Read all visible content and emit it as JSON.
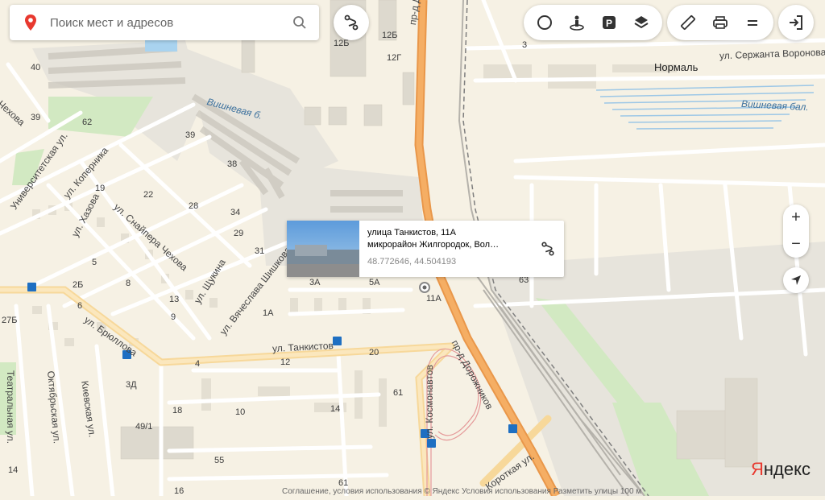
{
  "search": {
    "placeholder": "Поиск мест и адресов"
  },
  "toolbar": {
    "buttons": [
      "traffic-icon",
      "panorama-icon",
      "parking-icon",
      "layers-icon"
    ],
    "tools": [
      "ruler-icon",
      "print-icon",
      "menu-icon"
    ],
    "login": "login-icon"
  },
  "card": {
    "title": "улица Танкистов, 11А",
    "subtitle": "микрорайон Жилгородок, Вол…",
    "coords": "48.772646, 44.504193"
  },
  "zoom": {
    "in": "+",
    "out": "−"
  },
  "logo": {
    "text": "Яндекс"
  },
  "copyright": "Соглашение, условия использования  © Яндекс Условия использования  Разметить улицы  100 м",
  "colors": {
    "road_main": "#f2a74b",
    "road_secondary": "#f7d89a",
    "water": "#9cc7e6",
    "park": "#c9e6b6",
    "rail": "#8c8c8c",
    "pin": "#e8392f"
  },
  "map_labels": {
    "streets": [
      "пр-д Дорожников",
      "пр-д Дорожников",
      "ул. Сержанта Воронова",
      "ул. Танкистов",
      "ул. Брюллова",
      "ул. Вячеслава Шишкова",
      "ул. Щукина",
      "ул. Снайпера Чехова",
      "ул. Хазова",
      "ул. Коперника",
      "Университетская ул.",
      "Театральная ул.",
      "Октябрьская ул.",
      "Киевская ул.",
      "ул. Космонавтов",
      "Чехова",
      "Короткая ул."
    ],
    "water": [
      "Вишневая б.",
      "Вишневая бал."
    ],
    "places": [
      "Нормаль"
    ],
    "numbers": [
      "40",
      "39",
      "62",
      "12Б",
      "12Б",
      "12Г",
      "39",
      "38",
      "19",
      "22",
      "28",
      "34",
      "29",
      "31",
      "3",
      "3A",
      "5A",
      "11A",
      "1A",
      "5",
      "6",
      "8",
      "13",
      "9",
      "27Б",
      "2Б",
      "3Д",
      "49/1",
      "18",
      "10",
      "14",
      "55",
      "4",
      "12",
      "20",
      "61",
      "16",
      "61",
      "14",
      "63"
    ]
  }
}
